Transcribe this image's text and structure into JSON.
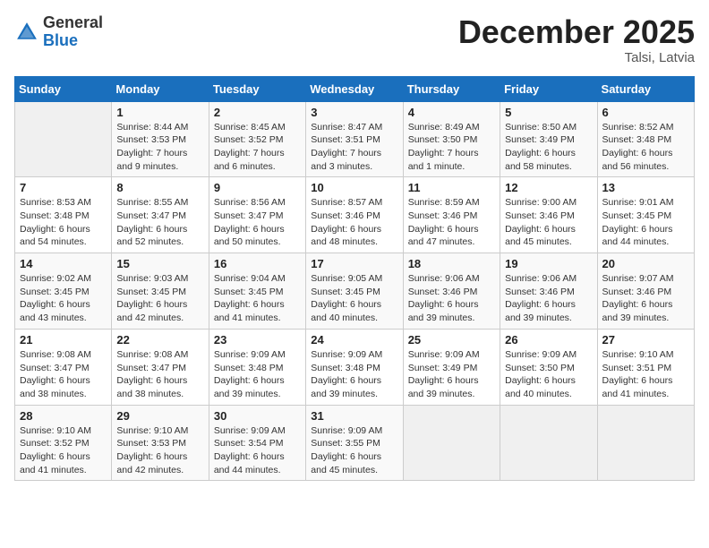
{
  "header": {
    "logo_line1": "General",
    "logo_line2": "Blue",
    "month": "December 2025",
    "location": "Talsi, Latvia"
  },
  "weekdays": [
    "Sunday",
    "Monday",
    "Tuesday",
    "Wednesday",
    "Thursday",
    "Friday",
    "Saturday"
  ],
  "weeks": [
    [
      {
        "day": "",
        "info": ""
      },
      {
        "day": "1",
        "info": "Sunrise: 8:44 AM\nSunset: 3:53 PM\nDaylight: 7 hours\nand 9 minutes."
      },
      {
        "day": "2",
        "info": "Sunrise: 8:45 AM\nSunset: 3:52 PM\nDaylight: 7 hours\nand 6 minutes."
      },
      {
        "day": "3",
        "info": "Sunrise: 8:47 AM\nSunset: 3:51 PM\nDaylight: 7 hours\nand 3 minutes."
      },
      {
        "day": "4",
        "info": "Sunrise: 8:49 AM\nSunset: 3:50 PM\nDaylight: 7 hours\nand 1 minute."
      },
      {
        "day": "5",
        "info": "Sunrise: 8:50 AM\nSunset: 3:49 PM\nDaylight: 6 hours\nand 58 minutes."
      },
      {
        "day": "6",
        "info": "Sunrise: 8:52 AM\nSunset: 3:48 PM\nDaylight: 6 hours\nand 56 minutes."
      }
    ],
    [
      {
        "day": "7",
        "info": "Sunrise: 8:53 AM\nSunset: 3:48 PM\nDaylight: 6 hours\nand 54 minutes."
      },
      {
        "day": "8",
        "info": "Sunrise: 8:55 AM\nSunset: 3:47 PM\nDaylight: 6 hours\nand 52 minutes."
      },
      {
        "day": "9",
        "info": "Sunrise: 8:56 AM\nSunset: 3:47 PM\nDaylight: 6 hours\nand 50 minutes."
      },
      {
        "day": "10",
        "info": "Sunrise: 8:57 AM\nSunset: 3:46 PM\nDaylight: 6 hours\nand 48 minutes."
      },
      {
        "day": "11",
        "info": "Sunrise: 8:59 AM\nSunset: 3:46 PM\nDaylight: 6 hours\nand 47 minutes."
      },
      {
        "day": "12",
        "info": "Sunrise: 9:00 AM\nSunset: 3:46 PM\nDaylight: 6 hours\nand 45 minutes."
      },
      {
        "day": "13",
        "info": "Sunrise: 9:01 AM\nSunset: 3:45 PM\nDaylight: 6 hours\nand 44 minutes."
      }
    ],
    [
      {
        "day": "14",
        "info": "Sunrise: 9:02 AM\nSunset: 3:45 PM\nDaylight: 6 hours\nand 43 minutes."
      },
      {
        "day": "15",
        "info": "Sunrise: 9:03 AM\nSunset: 3:45 PM\nDaylight: 6 hours\nand 42 minutes."
      },
      {
        "day": "16",
        "info": "Sunrise: 9:04 AM\nSunset: 3:45 PM\nDaylight: 6 hours\nand 41 minutes."
      },
      {
        "day": "17",
        "info": "Sunrise: 9:05 AM\nSunset: 3:45 PM\nDaylight: 6 hours\nand 40 minutes."
      },
      {
        "day": "18",
        "info": "Sunrise: 9:06 AM\nSunset: 3:46 PM\nDaylight: 6 hours\nand 39 minutes."
      },
      {
        "day": "19",
        "info": "Sunrise: 9:06 AM\nSunset: 3:46 PM\nDaylight: 6 hours\nand 39 minutes."
      },
      {
        "day": "20",
        "info": "Sunrise: 9:07 AM\nSunset: 3:46 PM\nDaylight: 6 hours\nand 39 minutes."
      }
    ],
    [
      {
        "day": "21",
        "info": "Sunrise: 9:08 AM\nSunset: 3:47 PM\nDaylight: 6 hours\nand 38 minutes."
      },
      {
        "day": "22",
        "info": "Sunrise: 9:08 AM\nSunset: 3:47 PM\nDaylight: 6 hours\nand 38 minutes."
      },
      {
        "day": "23",
        "info": "Sunrise: 9:09 AM\nSunset: 3:48 PM\nDaylight: 6 hours\nand 39 minutes."
      },
      {
        "day": "24",
        "info": "Sunrise: 9:09 AM\nSunset: 3:48 PM\nDaylight: 6 hours\nand 39 minutes."
      },
      {
        "day": "25",
        "info": "Sunrise: 9:09 AM\nSunset: 3:49 PM\nDaylight: 6 hours\nand 39 minutes."
      },
      {
        "day": "26",
        "info": "Sunrise: 9:09 AM\nSunset: 3:50 PM\nDaylight: 6 hours\nand 40 minutes."
      },
      {
        "day": "27",
        "info": "Sunrise: 9:10 AM\nSunset: 3:51 PM\nDaylight: 6 hours\nand 41 minutes."
      }
    ],
    [
      {
        "day": "28",
        "info": "Sunrise: 9:10 AM\nSunset: 3:52 PM\nDaylight: 6 hours\nand 41 minutes."
      },
      {
        "day": "29",
        "info": "Sunrise: 9:10 AM\nSunset: 3:53 PM\nDaylight: 6 hours\nand 42 minutes."
      },
      {
        "day": "30",
        "info": "Sunrise: 9:09 AM\nSunset: 3:54 PM\nDaylight: 6 hours\nand 44 minutes."
      },
      {
        "day": "31",
        "info": "Sunrise: 9:09 AM\nSunset: 3:55 PM\nDaylight: 6 hours\nand 45 minutes."
      },
      {
        "day": "",
        "info": ""
      },
      {
        "day": "",
        "info": ""
      },
      {
        "day": "",
        "info": ""
      }
    ]
  ]
}
